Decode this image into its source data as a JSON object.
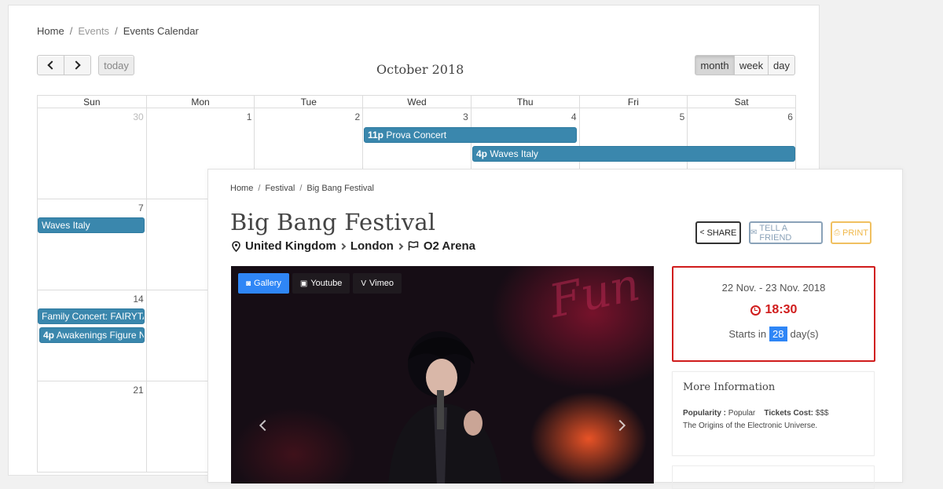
{
  "calendar": {
    "breadcrumb": [
      "Home",
      "Events",
      "Events Calendar"
    ],
    "title": "October 2018",
    "nav": {
      "today": "today"
    },
    "views": [
      "month",
      "week",
      "day"
    ],
    "active_view": "month",
    "weekdays": [
      "Sun",
      "Mon",
      "Tue",
      "Wed",
      "Thu",
      "Fri",
      "Sat"
    ],
    "weeks": [
      [
        "30",
        "1",
        "2",
        "3",
        "4",
        "5",
        "6"
      ],
      [
        "7",
        "",
        "",
        "",
        "",
        "",
        ""
      ],
      [
        "14",
        "",
        "",
        "",
        "",
        "",
        ""
      ],
      [
        "21",
        "",
        "",
        "",
        "",
        "",
        ""
      ]
    ],
    "events": {
      "prova": {
        "time": "11p",
        "title": "Prova Concert"
      },
      "waves": {
        "time": "4p",
        "title": "Waves Italy"
      },
      "waves_cont": {
        "title": "Waves Italy"
      },
      "family": {
        "title": "Family Concert: FAIRYTALE"
      },
      "awakenings": {
        "time": "4p",
        "title": "Awakenings Figure Nacht"
      }
    },
    "event_color": "#3a87ad"
  },
  "event": {
    "breadcrumb": [
      "Home",
      "Festival",
      "Big Bang Festival"
    ],
    "title": "Big Bang Festival",
    "location": {
      "country": "United Kingdom",
      "city": "London",
      "venue": "O2 Arena"
    },
    "actions": {
      "share": "SHARE",
      "tell": "TELL A FRIEND",
      "print": "PRINT"
    },
    "media_tabs": [
      "Gallery",
      "Youtube",
      "Vimeo"
    ],
    "active_tab": "Gallery",
    "date_range": "22 Nov. - 23 Nov. 2018",
    "time": "18:30",
    "starts_in": {
      "prefix": "Starts in",
      "days": "28",
      "suffix": "day(s)"
    },
    "more_info": {
      "heading": "More Information",
      "popularity_label": "Popularity :",
      "popularity": "Popular",
      "tickets_label": "Tickets Cost:",
      "tickets": "$$$",
      "description": "The Origins of the Electronic Universe."
    },
    "accent": "#2f86f6",
    "alert": "#d01c1c"
  }
}
